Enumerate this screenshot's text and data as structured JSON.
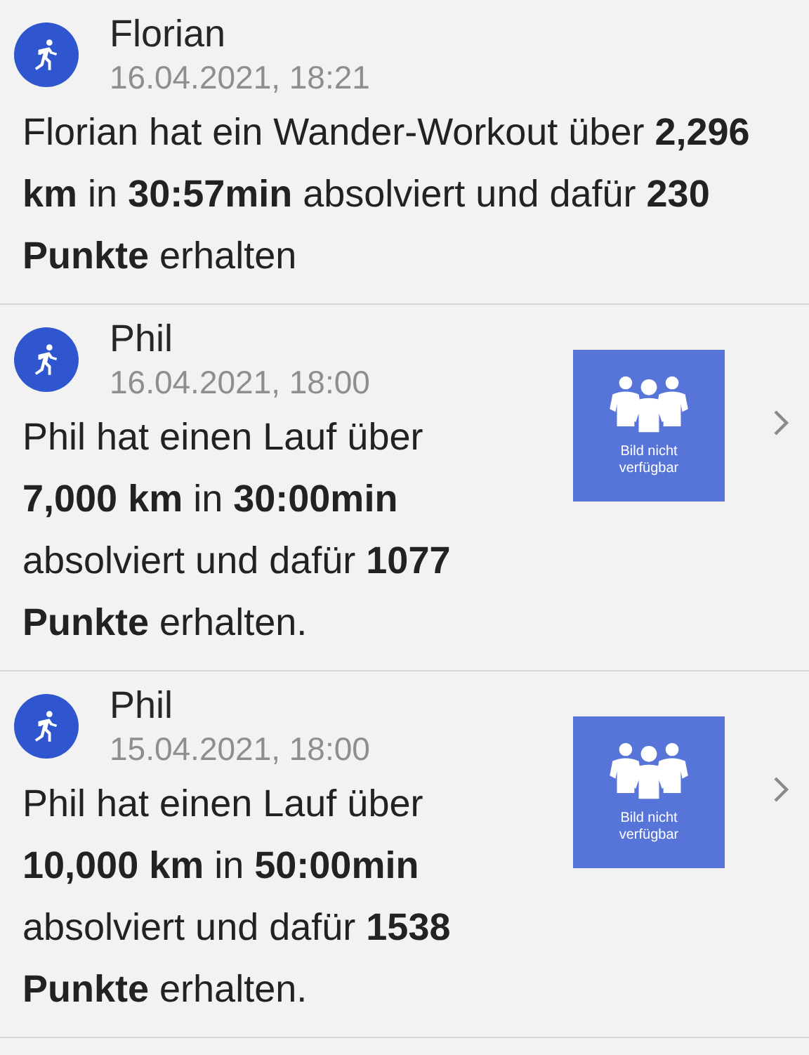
{
  "feed": [
    {
      "name": "Florian",
      "timestamp": "16.04.2021, 18:21",
      "message": "Florian hat ein Wander-Workout über **2,296 km** in **30:57min** absolviert und dafür **230 Punkte** erhalten"
    },
    {
      "name": "Phil",
      "timestamp": "16.04.2021, 18:00",
      "message": "Phil hat einen Lauf über **7,000 km** in **30:00min** absolviert und dafür **1077 Punkte** erhalten.",
      "image_caption": "Bild nicht verfügbar",
      "has_details": true
    },
    {
      "name": "Phil",
      "timestamp": "15.04.2021, 18:00",
      "message": "Phil hat einen Lauf über **10,000 km** in **50:00min** absolviert und dafür **1538 Punkte** erhalten.",
      "image_caption": "Bild nicht verfügbar",
      "has_details": true
    }
  ]
}
